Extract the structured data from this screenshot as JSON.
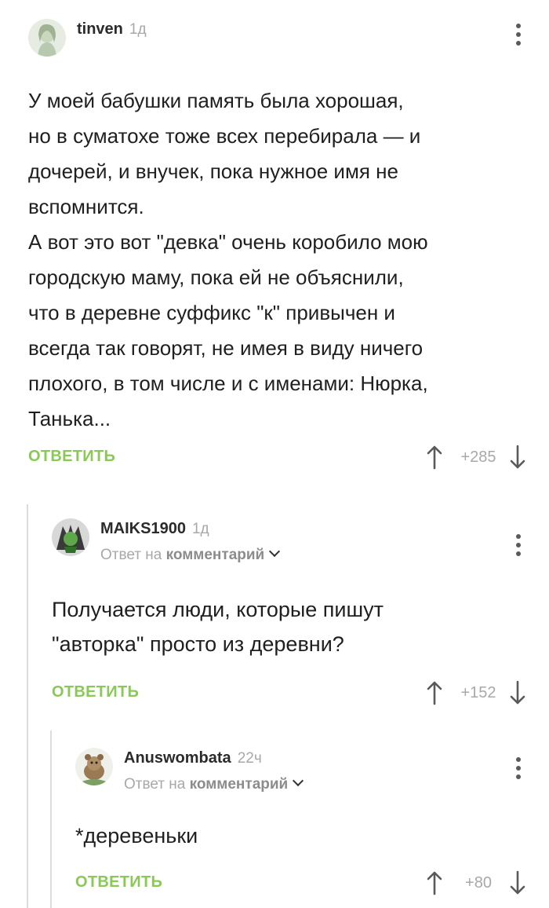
{
  "comments": [
    {
      "username": "tinven",
      "time": "1д",
      "text": "У моей бабушки память была хорошая,\nно в суматохе тоже всех перебирала — и\nдочерей, и внучек, пока нужное имя не\nвспомнится.\nА вот это вот \"девка\" очень коробило мою\nгородскую маму, пока ей не объяснили,\nчто в деревне суффикс \"к\" привычен и\nвсегда так говорят, не имея в виду ничего\nплохого, в том числе и с именами: Нюрка,\nТанька...",
      "reply_label": "ОТВЕТИТЬ",
      "score": "+285"
    },
    {
      "username": "MAIKS1900",
      "time": "1д",
      "reply_prefix": "Ответ на",
      "reply_link": "комментарий",
      "text": "Получается люди, которые пишут\n\"авторка\" просто из деревни?",
      "reply_label": "ОТВЕТИТЬ",
      "score": "+152"
    },
    {
      "username": "Anuswombata",
      "time": "22ч",
      "reply_prefix": "Ответ на",
      "reply_link": "комментарий",
      "text": "*деревеньки",
      "reply_label": "ОТВЕТИТЬ",
      "score": "+80"
    }
  ],
  "icons": {
    "more": "more-vertical-icon",
    "upvote": "arrow-up-icon",
    "downvote": "arrow-down-icon",
    "reply_chevron": "chevron-down-icon"
  },
  "colors": {
    "reply_button": "#8ac858",
    "meta_text": "#a8a8a8",
    "thread_line": "#dcdcdc"
  }
}
